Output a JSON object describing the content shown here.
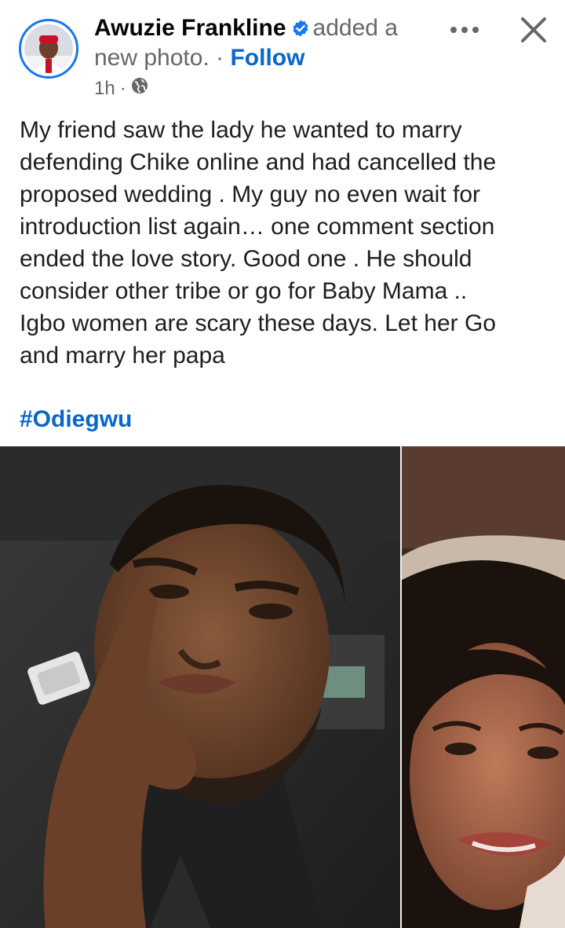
{
  "header": {
    "author": "Awuzie Frankline",
    "action_part1": "added a",
    "action_part2": "new photo.",
    "separator": "·",
    "follow_label": "Follow",
    "time": "1h",
    "time_separator": "·",
    "audience_icon": "globe-icon",
    "verified_icon": "verified-badge-icon",
    "more_icon": "more-dots-icon",
    "close_icon": "close-icon"
  },
  "post": {
    "text": "My friend saw the lady he wanted to marry\ndefending Chike online and had cancelled the\nproposed wedding . My guy no even wait for\nintroduction list again… one comment section\nended the love story. Good one . He should\nconsider other tribe or go for Baby Mama  ..\nIgbo women are scary these days. Let her Go\nand marry her papa",
    "hashtag": "#Odiegwu"
  },
  "colors": {
    "accent": "#1877f2",
    "link": "#0866c8",
    "muted_text": "#65676b"
  }
}
